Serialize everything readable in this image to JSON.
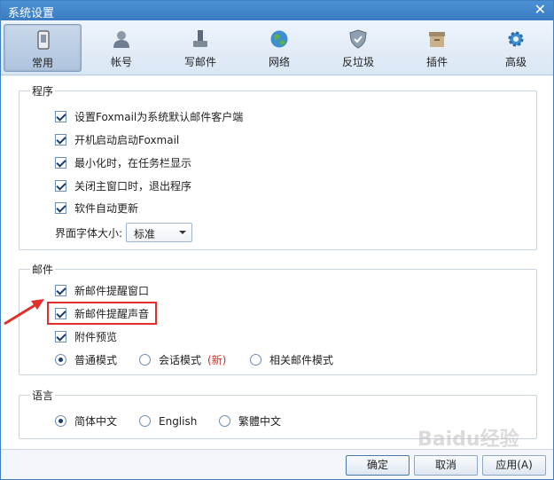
{
  "window": {
    "title": "系统设置",
    "close_glyph": "✕"
  },
  "toolbar": {
    "tabs": [
      {
        "label": "常用",
        "icon": "phone-icon",
        "active": true
      },
      {
        "label": "帐号",
        "icon": "user-icon",
        "active": false
      },
      {
        "label": "写邮件",
        "icon": "pen-icon",
        "active": false
      },
      {
        "label": "网络",
        "icon": "globe-icon",
        "active": false
      },
      {
        "label": "反垃圾",
        "icon": "shield-icon",
        "active": false
      },
      {
        "label": "插件",
        "icon": "box-icon",
        "active": false
      },
      {
        "label": "高级",
        "icon": "gear-icon",
        "active": false
      }
    ]
  },
  "program": {
    "title": "程序",
    "options": [
      {
        "label": "设置Foxmail为系统默认邮件客户端",
        "checked": true
      },
      {
        "label": "开机启动启动Foxmail",
        "checked": true
      },
      {
        "label": "最小化时，在任务栏显示",
        "checked": true
      },
      {
        "label": "关闭主窗口时，退出程序",
        "checked": true
      },
      {
        "label": "软件自动更新",
        "checked": true
      }
    ],
    "font_size_label": "界面字体大小:",
    "font_size_value": "标准"
  },
  "mail": {
    "title": "邮件",
    "options": [
      {
        "label": "新邮件提醒窗口",
        "checked": true
      },
      {
        "label": "新邮件提醒声音",
        "checked": true,
        "highlighted": true
      },
      {
        "label": "附件预览",
        "checked": true
      }
    ],
    "modes": [
      {
        "label": "普通模式",
        "selected": true
      },
      {
        "label": "会话模式",
        "note": "(新)",
        "selected": false
      },
      {
        "label": "相关邮件模式",
        "selected": false
      }
    ]
  },
  "language": {
    "title": "语言",
    "options": [
      {
        "label": "简体中文",
        "selected": true
      },
      {
        "label": "English",
        "selected": false
      },
      {
        "label": "繁體中文",
        "selected": false
      }
    ]
  },
  "buttons": {
    "ok": "确定",
    "cancel": "取消",
    "apply": "应用(A)"
  },
  "colors": {
    "titlebar": "#3a7cc2",
    "highlight": "#e0302a",
    "accent": "#1d3d6b"
  },
  "watermark": "Baidu经验"
}
